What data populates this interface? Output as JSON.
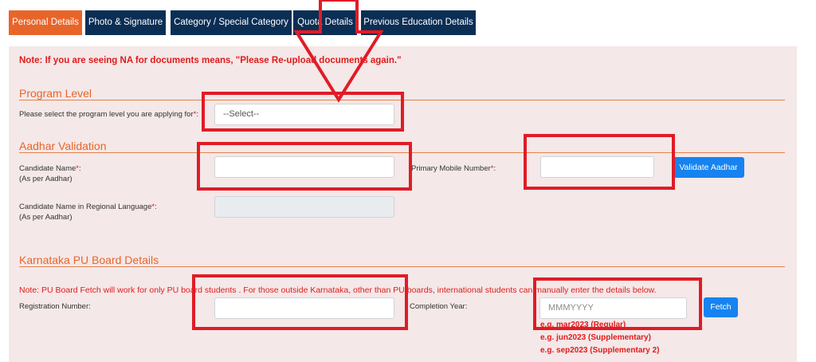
{
  "tabs": [
    {
      "label": "Personal Details",
      "active": true
    },
    {
      "label": "Photo & Signature",
      "active": false
    },
    {
      "label": "Category / Special Category",
      "active": false
    },
    {
      "label": "Quota Details",
      "active": false
    },
    {
      "label": "Previous Education Details",
      "active": false
    }
  ],
  "notice": "Note: If you are seeing NA for documents means, \"Please Re-upload documents again.\"",
  "program_level": {
    "title": "Program Level",
    "prompt": "Please select the program level you are applying for",
    "required_mark": "*",
    "colon": ":",
    "select_value": "--Select--"
  },
  "aadhar": {
    "title": "Aadhar Validation",
    "candidate_name_label": "Candidate Name",
    "candidate_name_sub": "(As per Aadhar)",
    "mobile_label": "Primary Mobile Number",
    "validate_button": "Validate Aadhar",
    "regional_name_label": "Candidate Name in Regional Language",
    "regional_name_sub": "(As per Aadhar)",
    "required_mark": "*",
    "colon": ":"
  },
  "pu_board": {
    "title": "Karnataka PU Board Details",
    "note": "Note: PU Board Fetch will work for only PU board students . For those outside Karnataka, other than PU boards, international students can manually enter the details below.",
    "registration_label": "Registration Number:",
    "completion_label": "Completion Year:",
    "completion_placeholder": "MMMYYYY",
    "fetch_button": "Fetch",
    "examples": [
      "e.g. mar2023 (Regular)",
      "e.g. jun2023 (Supplementary)",
      "e.g. sep2023 (Supplementary 2)"
    ]
  },
  "colors": {
    "tab_active": "#e8652a",
    "tab_inactive": "#0b2e55",
    "accent_orange": "#e8652a",
    "alert_red": "#e01b1b",
    "button_blue": "#1683f0",
    "panel_bg": "#f4e8e8",
    "annotation_red": "#e01c26"
  }
}
